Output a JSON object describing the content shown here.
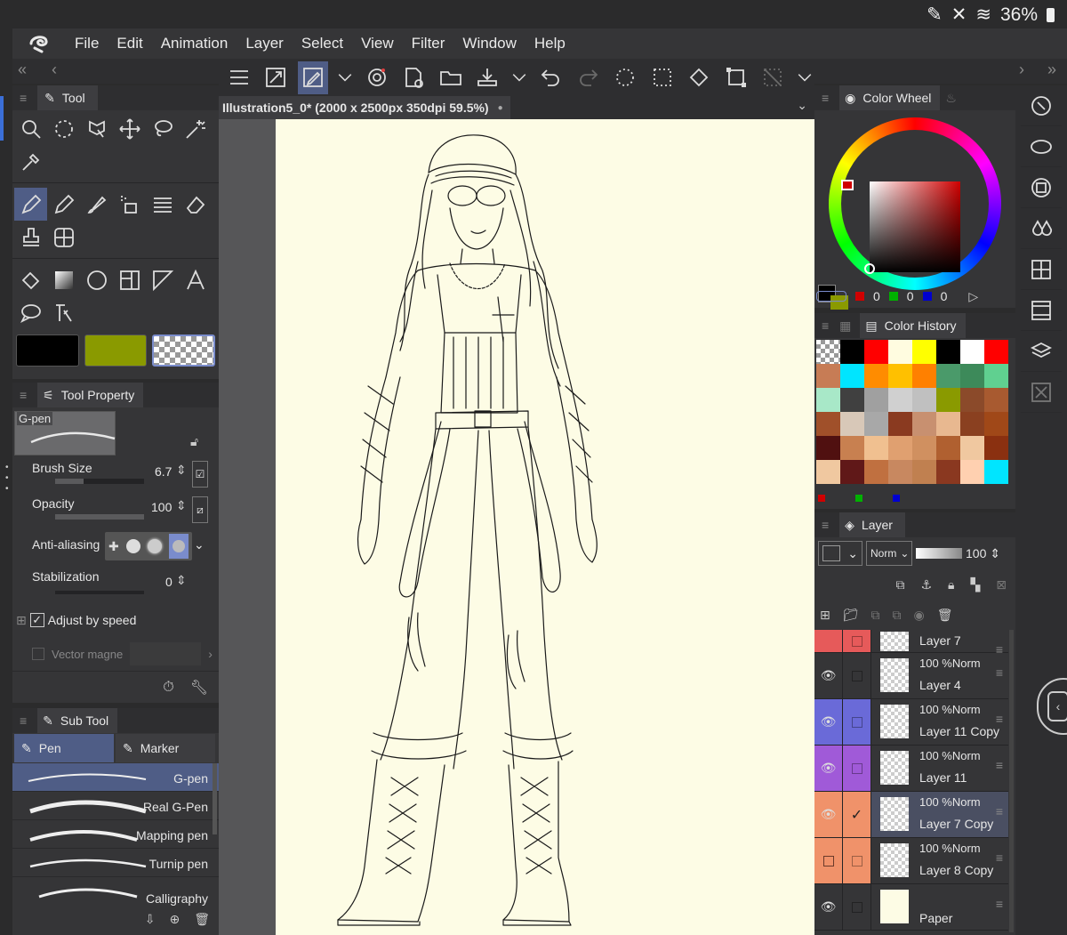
{
  "status": {
    "battery": "36%"
  },
  "menu": [
    "File",
    "Edit",
    "Animation",
    "Layer",
    "Select",
    "View",
    "Filter",
    "Window",
    "Help"
  ],
  "panels": {
    "tool": "Tool",
    "tool_property": "Tool Property",
    "sub_tool": "Sub Tool",
    "color_wheel": "Color Wheel",
    "color_history": "Color History",
    "layer": "Layer"
  },
  "document": {
    "tab_title": "Illustration5_0* (2000 x 2500px 350dpi 59.5%)"
  },
  "colors": {
    "main": "#000000",
    "sub": "#8a9a00",
    "accent": "#4f5d86"
  },
  "tool_property": {
    "brush_name": "G-pen",
    "brush_size_label": "Brush Size",
    "brush_size": "6.7",
    "opacity_label": "Opacity",
    "opacity": "100",
    "anti_aliasing_label": "Anti-aliasing",
    "stabilization_label": "Stabilization",
    "stabilization": "0",
    "adjust_by_speed_label": "Adjust by speed",
    "vector_magnet_label": "Vector magne"
  },
  "sub_tool": {
    "tabs": [
      "Pen",
      "Marker"
    ],
    "brushes": [
      "G-pen",
      "Real G-Pen",
      "Mapping pen",
      "Turnip pen",
      "Calligraphy"
    ]
  },
  "color_values": {
    "r": "0",
    "g": "0",
    "b": "0"
  },
  "layer_panel": {
    "blend_mode": "Norm",
    "opacity": "100",
    "layers": [
      {
        "name": "Layer 7",
        "meta": "",
        "color": "#e65a5a",
        "visible": false,
        "selected": false
      },
      {
        "name": "Layer 4",
        "meta": "100 %Norm",
        "color": "#353537",
        "visible": true,
        "selected": false
      },
      {
        "name": "Layer 11 Copy",
        "meta": "100 %Norm",
        "color": "#6a6ad8",
        "visible": true,
        "selected": false
      },
      {
        "name": "Layer 11",
        "meta": "100 %Norm",
        "color": "#a05ad8",
        "visible": true,
        "selected": false
      },
      {
        "name": "Layer 7 Copy",
        "meta": "100 %Norm",
        "color": "#f0926a",
        "visible": true,
        "selected": true
      },
      {
        "name": "Layer 8 Copy",
        "meta": "100 %Norm",
        "color": "#f0926a",
        "visible": false,
        "selected": false
      },
      {
        "name": "Paper",
        "meta": "",
        "color": "#353537",
        "visible": true,
        "selected": false
      }
    ]
  },
  "history_colors": [
    "checker",
    "#000000",
    "#ff0000",
    "#fffce0",
    "#ffff00",
    "#000000",
    "#ffffff",
    "#ff0000",
    "#c77c55",
    "#00e5ff",
    "#ff8c00",
    "#ffc000",
    "#ff8000",
    "#4a9a6a",
    "#3d8a5a",
    "#60d090",
    "#a8e8c8",
    "#404040",
    "#a0a0a0",
    "#d0d0d0",
    "#c0c0c0",
    "#8a9a00",
    "#8b4a2a",
    "#a85a30",
    "#a0502a",
    "#d8c8b8",
    "#a8a8a8",
    "#8a3a20",
    "#c89070",
    "#e8b890",
    "#8a4020",
    "#a04818",
    "#501010",
    "#c88050",
    "#f0c090",
    "#e0a070",
    "#d09060",
    "#b06030",
    "#f0c8a0",
    "#8a3010",
    "#f0c8a0",
    "#601818",
    "#c07040",
    "#c88860",
    "#c08050",
    "#8a3820",
    "#ffd0b0",
    "#00e5ff"
  ]
}
